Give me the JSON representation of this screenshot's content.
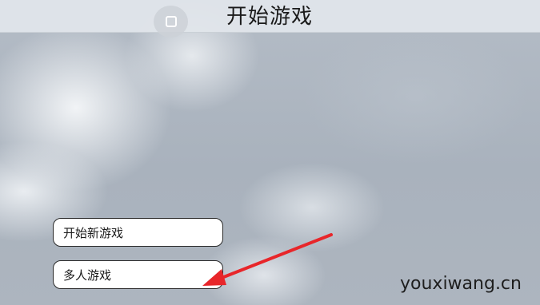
{
  "header": {
    "title": "开始游戏",
    "home_icon": "square-home-icon"
  },
  "menu": {
    "new_game_label": "开始新游戏",
    "multiplayer_label": "多人游戏"
  },
  "annotation": {
    "arrow_color": "#e8262a",
    "arrow_target": "multiplayer-button"
  },
  "watermark": {
    "text": "youxiwang.cn"
  }
}
